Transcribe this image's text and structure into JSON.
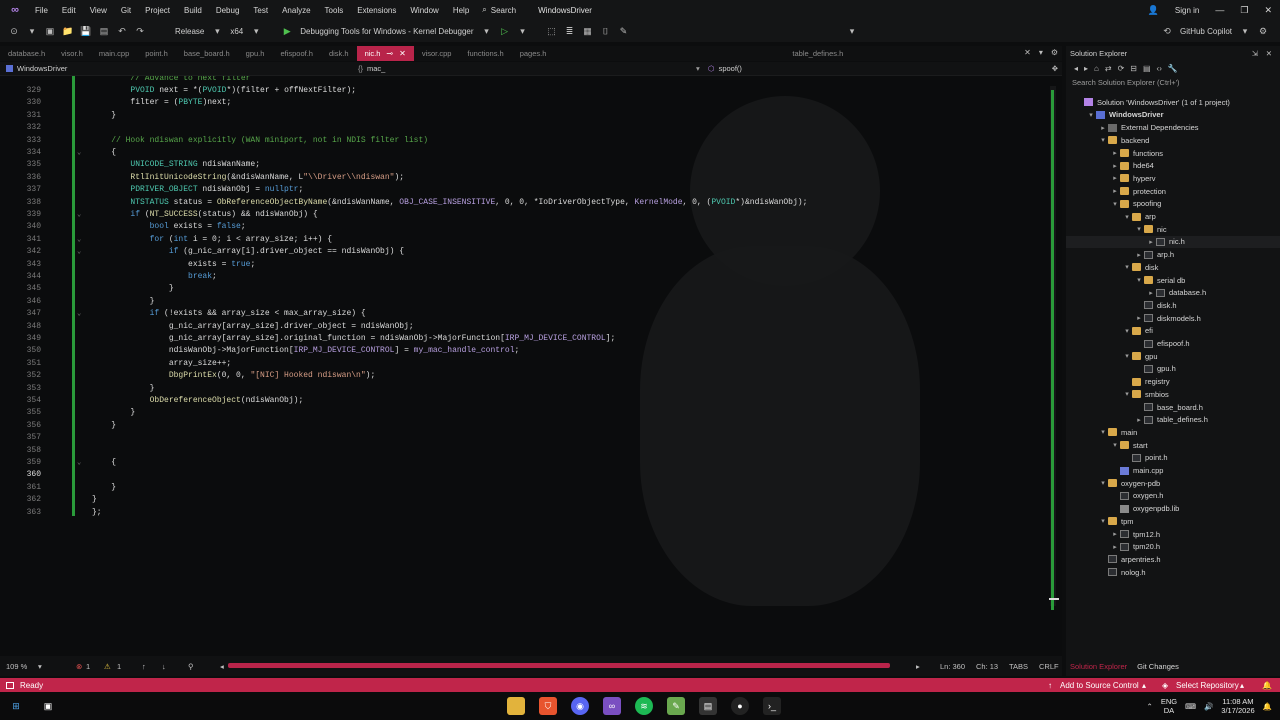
{
  "titlebar": {
    "menu": [
      "File",
      "Edit",
      "View",
      "Git",
      "Project",
      "Build",
      "Debug",
      "Test",
      "Analyze",
      "Tools",
      "Extensions",
      "Window",
      "Help"
    ],
    "search_label": "Search",
    "window_title": "WindowsDriver",
    "sign_in": "Sign in"
  },
  "toolbar": {
    "configuration": "Release",
    "platform": "x64",
    "debugger": "Debugging Tools for Windows - Kernel Debugger",
    "copilot": "GitHub Copilot"
  },
  "tabs": [
    {
      "label": "database.h",
      "active": false
    },
    {
      "label": "visor.h",
      "active": false
    },
    {
      "label": "main.cpp",
      "active": false
    },
    {
      "label": "point.h",
      "active": false
    },
    {
      "label": "base_board.h",
      "active": false
    },
    {
      "label": "gpu.h",
      "active": false
    },
    {
      "label": "efispoof.h",
      "active": false
    },
    {
      "label": "disk.h",
      "active": false
    },
    {
      "label": "nic.h",
      "active": true
    },
    {
      "label": "visor.cpp",
      "active": false
    },
    {
      "label": "functions.h",
      "active": false
    },
    {
      "label": "pages.h",
      "active": false
    },
    {
      "label": "table_defines.h",
      "active": false
    }
  ],
  "navbar": {
    "project": "WindowsDriver",
    "scope": "mac_",
    "member": "spoof()"
  },
  "editor": {
    "lines": [
      {
        "n": "",
        "t": "        // Advance to next filter"
      },
      {
        "n": "329",
        "t": "        PVOID next = *(PVOID*)(filter + offNextFilter);"
      },
      {
        "n": "330",
        "t": "        filter = (PBYTE)next;"
      },
      {
        "n": "331",
        "t": "    }"
      },
      {
        "n": "332",
        "t": ""
      },
      {
        "n": "333",
        "t": "    // Hook ndiswan explicitly (WAN miniport, not in NDIS filter list)"
      },
      {
        "n": "334",
        "t": "    {"
      },
      {
        "n": "335",
        "t": "        UNICODE_STRING ndisWanName;"
      },
      {
        "n": "336",
        "t": "        RtlInitUnicodeString(&ndisWanName, L\"\\\\Driver\\\\ndiswan\");"
      },
      {
        "n": "337",
        "t": "        PDRIVER_OBJECT ndisWanObj = nullptr;"
      },
      {
        "n": "338",
        "t": "        NTSTATUS status = ObReferenceObjectByName(&ndisWanName, OBJ_CASE_INSENSITIVE, 0, 0, *IoDriverObjectType, KernelMode, 0, (PVOID*)&ndisWanObj);"
      },
      {
        "n": "339",
        "t": "        if (NT_SUCCESS(status) && ndisWanObj) {"
      },
      {
        "n": "340",
        "t": "            bool exists = false;"
      },
      {
        "n": "341",
        "t": "            for (int i = 0; i < array_size; i++) {"
      },
      {
        "n": "342",
        "t": "                if (g_nic_array[i].driver_object == ndisWanObj) {"
      },
      {
        "n": "343",
        "t": "                    exists = true;"
      },
      {
        "n": "344",
        "t": "                    break;"
      },
      {
        "n": "345",
        "t": "                }"
      },
      {
        "n": "346",
        "t": "            }"
      },
      {
        "n": "347",
        "t": "            if (!exists && array_size < max_array_size) {"
      },
      {
        "n": "348",
        "t": "                g_nic_array[array_size].driver_object = ndisWanObj;"
      },
      {
        "n": "349",
        "t": "                g_nic_array[array_size].original_function = ndisWanObj->MajorFunction[IRP_MJ_DEVICE_CONTROL];"
      },
      {
        "n": "350",
        "t": "                ndisWanObj->MajorFunction[IRP_MJ_DEVICE_CONTROL] = my_mac_handle_control;"
      },
      {
        "n": "351",
        "t": "                array_size++;"
      },
      {
        "n": "352",
        "t": "                DbgPrintEx(0, 0, \"[NIC] Hooked ndiswan\\n\");"
      },
      {
        "n": "353",
        "t": "            }"
      },
      {
        "n": "354",
        "t": "            ObDereferenceObject(ndisWanObj);"
      },
      {
        "n": "355",
        "t": "        }"
      },
      {
        "n": "356",
        "t": "    }"
      },
      {
        "n": "357",
        "t": ""
      },
      {
        "n": "358",
        "t": ""
      },
      {
        "n": "359",
        "t": "    {"
      },
      {
        "n": "360",
        "t": ""
      },
      {
        "n": "361",
        "t": "    }"
      },
      {
        "n": "362",
        "t": "}"
      },
      {
        "n": "363",
        "t": "};"
      }
    ]
  },
  "editor_status": {
    "zoom": "109 %",
    "errors": "1",
    "warnings": "1",
    "position": "Ln: 360",
    "column": "Ch: 13",
    "indent": "TABS",
    "eol": "CRLF"
  },
  "solution_explorer": {
    "title": "Solution Explorer",
    "search_placeholder": "Search Solution Explorer (Ctrl+')",
    "footer_tabs": [
      "Solution Explorer",
      "Git Changes"
    ],
    "items": [
      {
        "label": "Solution 'WindowsDriver' (1 of 1 project)",
        "depth": 0,
        "type": "sol",
        "arrow": ""
      },
      {
        "label": "WindowsDriver",
        "depth": 1,
        "type": "proj",
        "arrow": "▾"
      },
      {
        "label": "External Dependencies",
        "depth": 2,
        "type": "ext",
        "arrow": "▸"
      },
      {
        "label": "backend",
        "depth": 2,
        "type": "folder",
        "arrow": "▾"
      },
      {
        "label": "functions",
        "depth": 3,
        "type": "folder",
        "arrow": "▸"
      },
      {
        "label": "hde64",
        "depth": 3,
        "type": "folder",
        "arrow": "▸"
      },
      {
        "label": "hyperv",
        "depth": 3,
        "type": "folder",
        "arrow": "▸"
      },
      {
        "label": "protection",
        "depth": 3,
        "type": "folder",
        "arrow": "▸"
      },
      {
        "label": "spoofing",
        "depth": 3,
        "type": "folder",
        "arrow": "▾"
      },
      {
        "label": "arp",
        "depth": 4,
        "type": "folder",
        "arrow": "▾"
      },
      {
        "label": "nic",
        "depth": 5,
        "type": "folder",
        "arrow": "▾"
      },
      {
        "label": "nic.h",
        "depth": 6,
        "type": "h",
        "arrow": "▸",
        "sel": true
      },
      {
        "label": "arp.h",
        "depth": 5,
        "type": "h",
        "arrow": "▸"
      },
      {
        "label": "disk",
        "depth": 4,
        "type": "folder",
        "arrow": "▾"
      },
      {
        "label": "serial db",
        "depth": 5,
        "type": "folder",
        "arrow": "▾"
      },
      {
        "label": "database.h",
        "depth": 6,
        "type": "h",
        "arrow": "▸"
      },
      {
        "label": "disk.h",
        "depth": 5,
        "type": "h",
        "arrow": ""
      },
      {
        "label": "diskmodels.h",
        "depth": 5,
        "type": "h",
        "arrow": "▸"
      },
      {
        "label": "efi",
        "depth": 4,
        "type": "folder",
        "arrow": "▾"
      },
      {
        "label": "efispoof.h",
        "depth": 5,
        "type": "h",
        "arrow": ""
      },
      {
        "label": "gpu",
        "depth": 4,
        "type": "folder",
        "arrow": "▾"
      },
      {
        "label": "gpu.h",
        "depth": 5,
        "type": "h",
        "arrow": ""
      },
      {
        "label": "registry",
        "depth": 4,
        "type": "folder",
        "arrow": ""
      },
      {
        "label": "smbios",
        "depth": 4,
        "type": "folder",
        "arrow": "▾"
      },
      {
        "label": "base_board.h",
        "depth": 5,
        "type": "h",
        "arrow": ""
      },
      {
        "label": "table_defines.h",
        "depth": 5,
        "type": "h",
        "arrow": "▸"
      },
      {
        "label": "main",
        "depth": 2,
        "type": "folder",
        "arrow": "▾"
      },
      {
        "label": "start",
        "depth": 3,
        "type": "folder",
        "arrow": "▾"
      },
      {
        "label": "point.h",
        "depth": 4,
        "type": "h",
        "arrow": ""
      },
      {
        "label": "main.cpp",
        "depth": 3,
        "type": "cpp",
        "arrow": ""
      },
      {
        "label": "oxygen-pdb",
        "depth": 2,
        "type": "folder",
        "arrow": "▾"
      },
      {
        "label": "oxygen.h",
        "depth": 3,
        "type": "h",
        "arrow": ""
      },
      {
        "label": "oxygenpdb.lib",
        "depth": 3,
        "type": "lib",
        "arrow": ""
      },
      {
        "label": "tpm",
        "depth": 2,
        "type": "folder",
        "arrow": "▾"
      },
      {
        "label": "tpm12.h",
        "depth": 3,
        "type": "h",
        "arrow": "▸"
      },
      {
        "label": "tpm20.h",
        "depth": 3,
        "type": "h",
        "arrow": "▸"
      },
      {
        "label": "arpentries.h",
        "depth": 2,
        "type": "h",
        "arrow": ""
      },
      {
        "label": "nolog.h",
        "depth": 2,
        "type": "h",
        "arrow": ""
      }
    ]
  },
  "statusbar": {
    "ready": "Ready",
    "add_source": "Add to Source Control",
    "select_repo": "Select Repository"
  },
  "taskbar": {
    "lang": "ENG",
    "region": "DA",
    "time": "11:08 AM",
    "date": "3/17/2026"
  },
  "colors": {
    "accent": "#c0254a",
    "active_tab": "#b8244a",
    "change_bar": "#2a9b3a",
    "keyword": "#569cd6",
    "type": "#4ec9b0",
    "string": "#d69d85",
    "comment": "#57a64a",
    "function": "#dcdcaa"
  }
}
